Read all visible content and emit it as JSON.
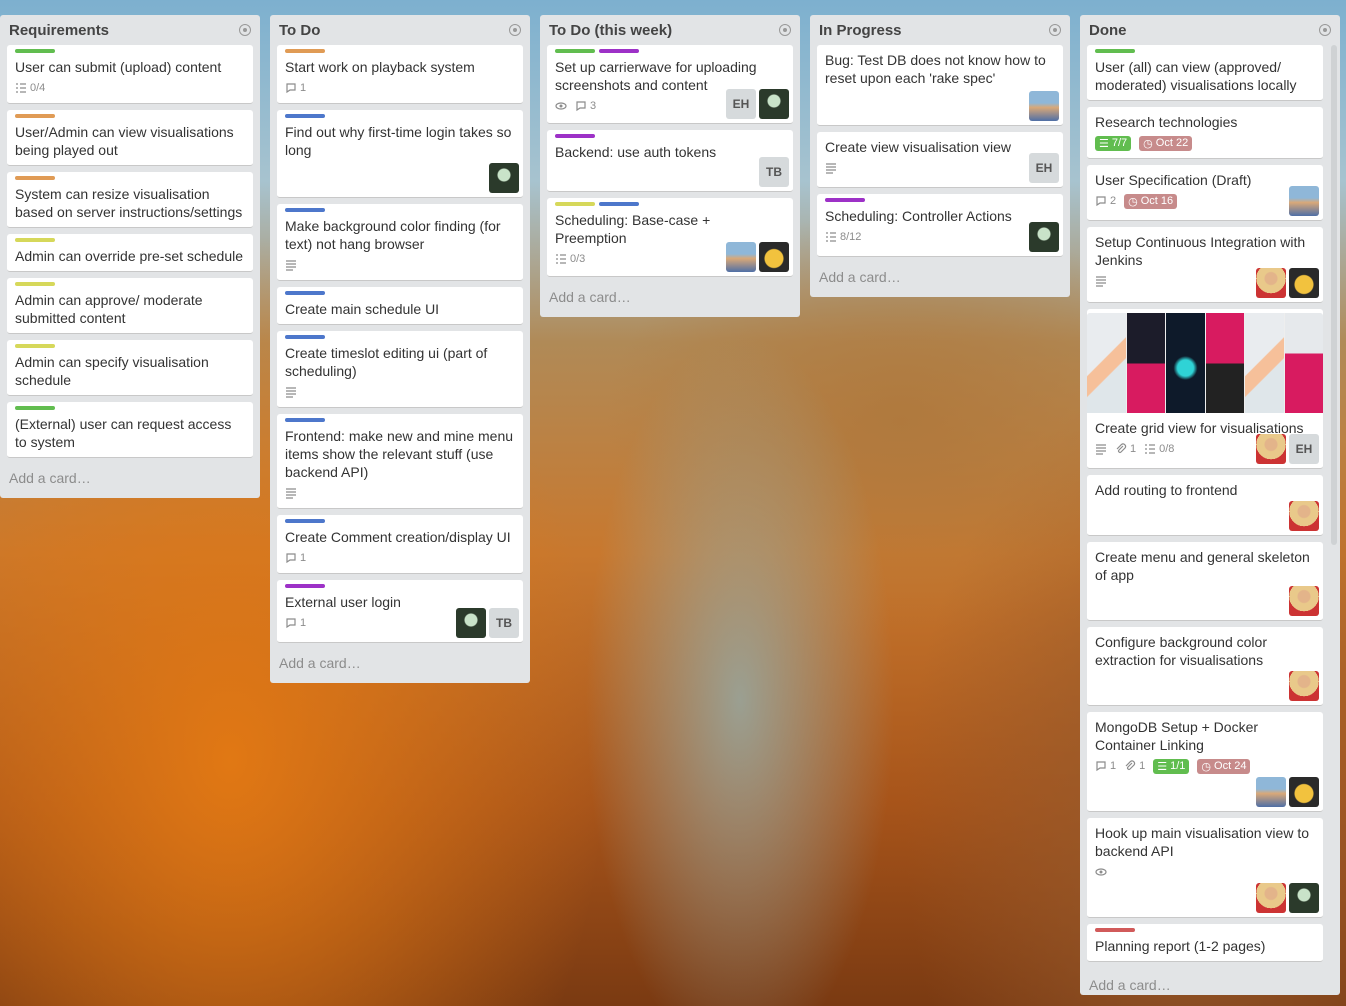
{
  "colors": {
    "green": "#61bd4f",
    "orange": "#e09b55",
    "yellow": "#d6d85a",
    "blue": "#4d77cb",
    "purple": "#9d31c7",
    "red": "#d15a5a"
  },
  "lists": [
    {
      "title": "Requirements",
      "add_card": "Add a card…",
      "cards": [
        {
          "title": "User can submit (upload) content",
          "checklist": "0/4"
        },
        {
          "title": "User/Admin can view visualisations being played out"
        },
        {
          "title": "System can resize visualisation based on server instructions/settings"
        },
        {
          "title": "Admin can override pre-set schedule"
        },
        {
          "title": "Admin can approve/ moderate submitted content"
        },
        {
          "title": "Admin can specify visualisation schedule"
        },
        {
          "title": "(External) user can request access to system"
        }
      ]
    },
    {
      "title": "To Do",
      "add_card": "Add a card…",
      "cards": [
        {
          "title": "Start work on playback system",
          "comments": "1"
        },
        {
          "title": "Find out why first-time login takes so long"
        },
        {
          "title": "Make background color finding (for text) not hang browser"
        },
        {
          "title": "Create main schedule UI"
        },
        {
          "title": "Create timeslot editing ui (part of scheduling)"
        },
        {
          "title": "Frontend: make new and mine menu items show the relevant stuff (use backend API)"
        },
        {
          "title": "Create Comment creation/display UI",
          "comments": "1"
        },
        {
          "title": "External user login",
          "comments": "1",
          "member_initials": "TB"
        }
      ]
    },
    {
      "title": "To Do (this week)",
      "add_card": "Add a card…",
      "cards": [
        {
          "title": "Set up carrierwave for uploading screenshots and content",
          "comments": "3",
          "member_initials": "EH"
        },
        {
          "title": "Backend: use auth tokens",
          "member_initials": "TB"
        },
        {
          "title": "Scheduling: Base-case + Preemption",
          "checklist": "0/3"
        }
      ]
    },
    {
      "title": "In Progress",
      "add_card": "Add a card…",
      "cards": [
        {
          "title": "Bug: Test DB does not know how to reset upon each 'rake spec'"
        },
        {
          "title": "Create view visualisation view",
          "member_initials": "EH"
        },
        {
          "title": "Scheduling: Controller Actions",
          "checklist": "8/12"
        }
      ]
    },
    {
      "title": "Done",
      "add_card": "Add a card…",
      "cards": [
        {
          "title": "User (all) can view (approved/ moderated) visualisations locally"
        },
        {
          "title": "Research technologies",
          "checklist": "7/7",
          "due": "Oct 22"
        },
        {
          "title": "User Specification (Draft)",
          "comments": "2",
          "due": "Oct 16"
        },
        {
          "title": "Setup Continuous Integration with Jenkins"
        },
        {
          "title": "Create grid view for visualisations",
          "attachments": "1",
          "checklist": "0/8",
          "member_initials": "EH"
        },
        {
          "title": "Add routing to frontend"
        },
        {
          "title": "Create menu and general skeleton of app"
        },
        {
          "title": "Configure background color extraction for visualisations"
        },
        {
          "title": "MongoDB Setup + Docker Container Linking",
          "comments": "1",
          "attachments": "1",
          "checklist": "1/1",
          "due": "Oct 24"
        },
        {
          "title": "Hook up main visualisation view to backend API"
        },
        {
          "title": "Planning report (1-2 pages)"
        }
      ]
    }
  ]
}
